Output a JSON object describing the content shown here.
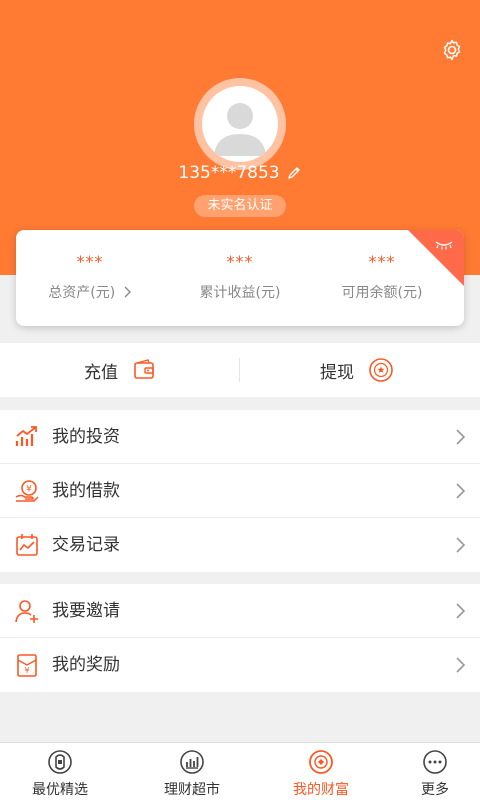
{
  "header": {
    "phone": "135***7853",
    "verify_badge": "未实名认证"
  },
  "summary": {
    "items": [
      {
        "value": "***",
        "label": "总资产(元)"
      },
      {
        "value": "***",
        "label": "累计收益(元)"
      },
      {
        "value": "***",
        "label": "可用余额(元)"
      }
    ]
  },
  "actions": {
    "recharge": "充值",
    "withdraw": "提现"
  },
  "menu1": [
    {
      "label": "我的投资"
    },
    {
      "label": "我的借款"
    },
    {
      "label": "交易记录"
    }
  ],
  "menu2": [
    {
      "label": "我要邀请"
    },
    {
      "label": "我的奖励"
    }
  ],
  "tabs": [
    {
      "label": "最优精选"
    },
    {
      "label": "理财超市"
    },
    {
      "label": "我的财富"
    },
    {
      "label": "更多"
    }
  ],
  "icons": {
    "settings": "gear-icon",
    "edit": "pencil-icon",
    "hide": "eye-closed-icon",
    "recharge": "wallet-icon",
    "withdraw": "coin-icon",
    "invest": "chart-up-icon",
    "loan": "hand-coin-icon",
    "records": "calendar-chart-icon",
    "invite": "add-user-icon",
    "rewards": "red-envelope-icon",
    "more": "dots-icon"
  },
  "colors": {
    "brand": "#ff7a33",
    "accent": "#ff5722"
  }
}
